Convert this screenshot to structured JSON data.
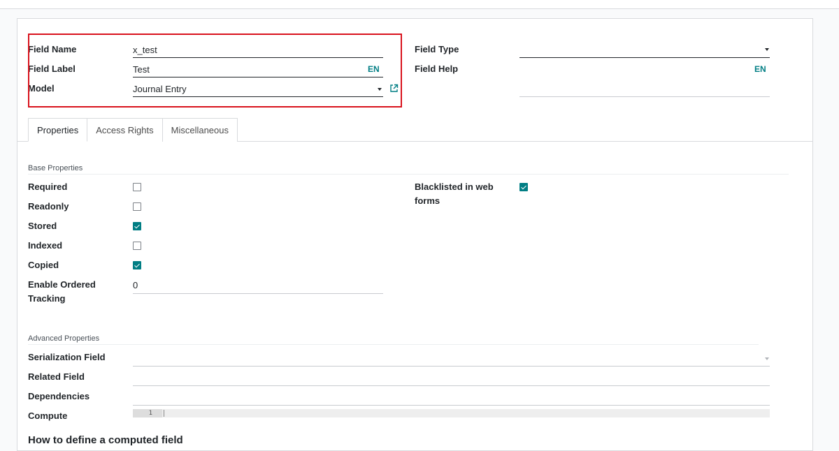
{
  "header": {
    "field_name": {
      "label": "Field Name",
      "value": "x_test"
    },
    "field_label": {
      "label": "Field Label",
      "value": "Test",
      "lang": "EN"
    },
    "model": {
      "label": "Model",
      "value": "Journal Entry"
    },
    "field_type": {
      "label": "Field Type",
      "value": ""
    },
    "field_help": {
      "label": "Field Help",
      "value": "",
      "lang": "EN"
    }
  },
  "tabs": [
    {
      "label": "Properties",
      "active": true
    },
    {
      "label": "Access Rights",
      "active": false
    },
    {
      "label": "Miscellaneous",
      "active": false
    }
  ],
  "base_properties": {
    "title": "Base Properties",
    "required": {
      "label": "Required",
      "checked": false
    },
    "readonly": {
      "label": "Readonly",
      "checked": false
    },
    "stored": {
      "label": "Stored",
      "checked": true
    },
    "indexed": {
      "label": "Indexed",
      "checked": false
    },
    "copied": {
      "label": "Copied",
      "checked": true
    },
    "ordered_tracking": {
      "label_line1": "Enable Ordered",
      "label_line2": "Tracking",
      "value": "0"
    },
    "blacklisted": {
      "label_line1": "Blacklisted in web",
      "label_line2": "forms",
      "checked": true
    }
  },
  "advanced_properties": {
    "title": "Advanced Properties",
    "serialization_field": {
      "label": "Serialization Field",
      "value": ""
    },
    "related_field": {
      "label": "Related Field",
      "value": ""
    },
    "dependencies": {
      "label": "Dependencies",
      "value": ""
    },
    "compute": {
      "label": "Compute",
      "line_number": "1"
    }
  },
  "cut_off_heading": "How to define a computed field",
  "colors": {
    "accent": "#017e84",
    "highlight_border": "#d9121c"
  },
  "icons": {
    "model_link": "external-link-icon",
    "dropdown": "caret-down-icon"
  }
}
